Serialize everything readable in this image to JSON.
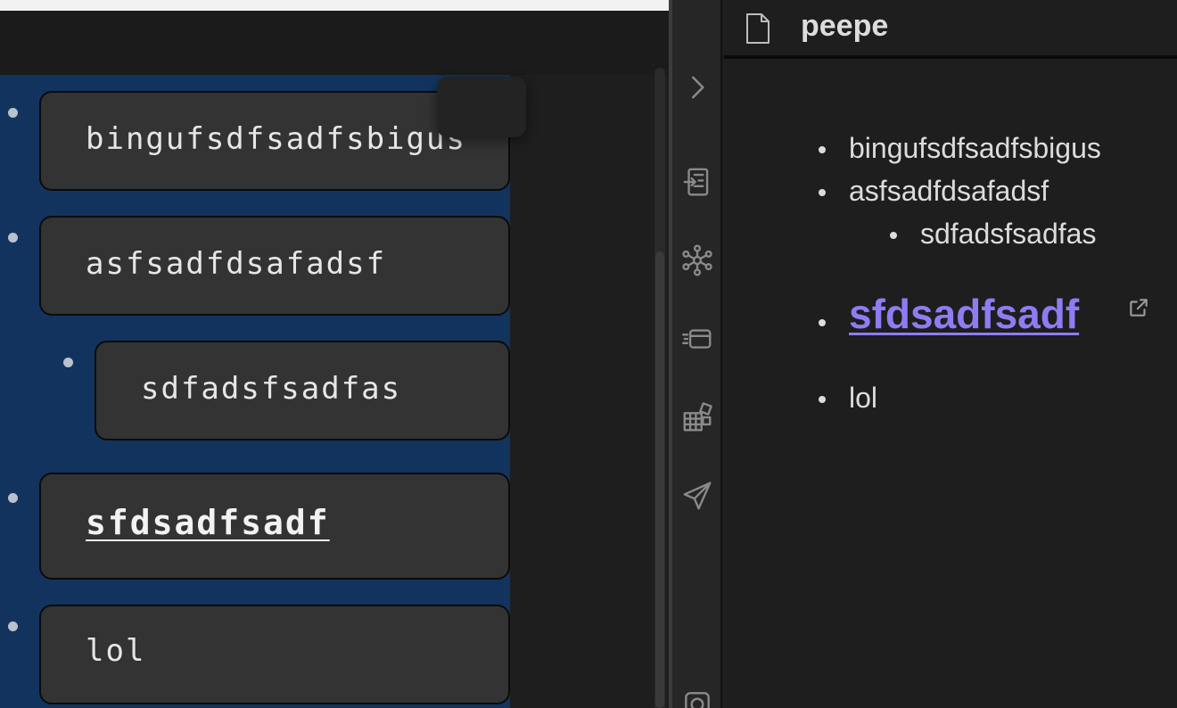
{
  "editor": {
    "cards": [
      {
        "text": "bingufsdfsadfsbigus"
      },
      {
        "text": "asfsadfdsafadsf"
      },
      {
        "text": "sdfadsfsadfas"
      },
      {
        "text": "sfdsadfsadf"
      },
      {
        "text": "lol"
      }
    ]
  },
  "ribbon": {
    "icons": [
      "chevron-right-icon",
      "file-import-icon",
      "graph-icon",
      "slides-icon",
      "blocks-icon",
      "send-icon",
      "camera-icon"
    ]
  },
  "preview": {
    "title": "peepe",
    "items": [
      {
        "text": "bingufsdfsadfsbigus"
      },
      {
        "text": "asfsadfdsafadsf"
      },
      {
        "text": "sdfadsfsadfas"
      },
      {
        "text": "sfdsadfsadf"
      },
      {
        "text": "lol"
      }
    ]
  },
  "colors": {
    "canvas_bg": "#13335f",
    "link_accent": "#8d7cf2",
    "card_bg": "#333333"
  }
}
